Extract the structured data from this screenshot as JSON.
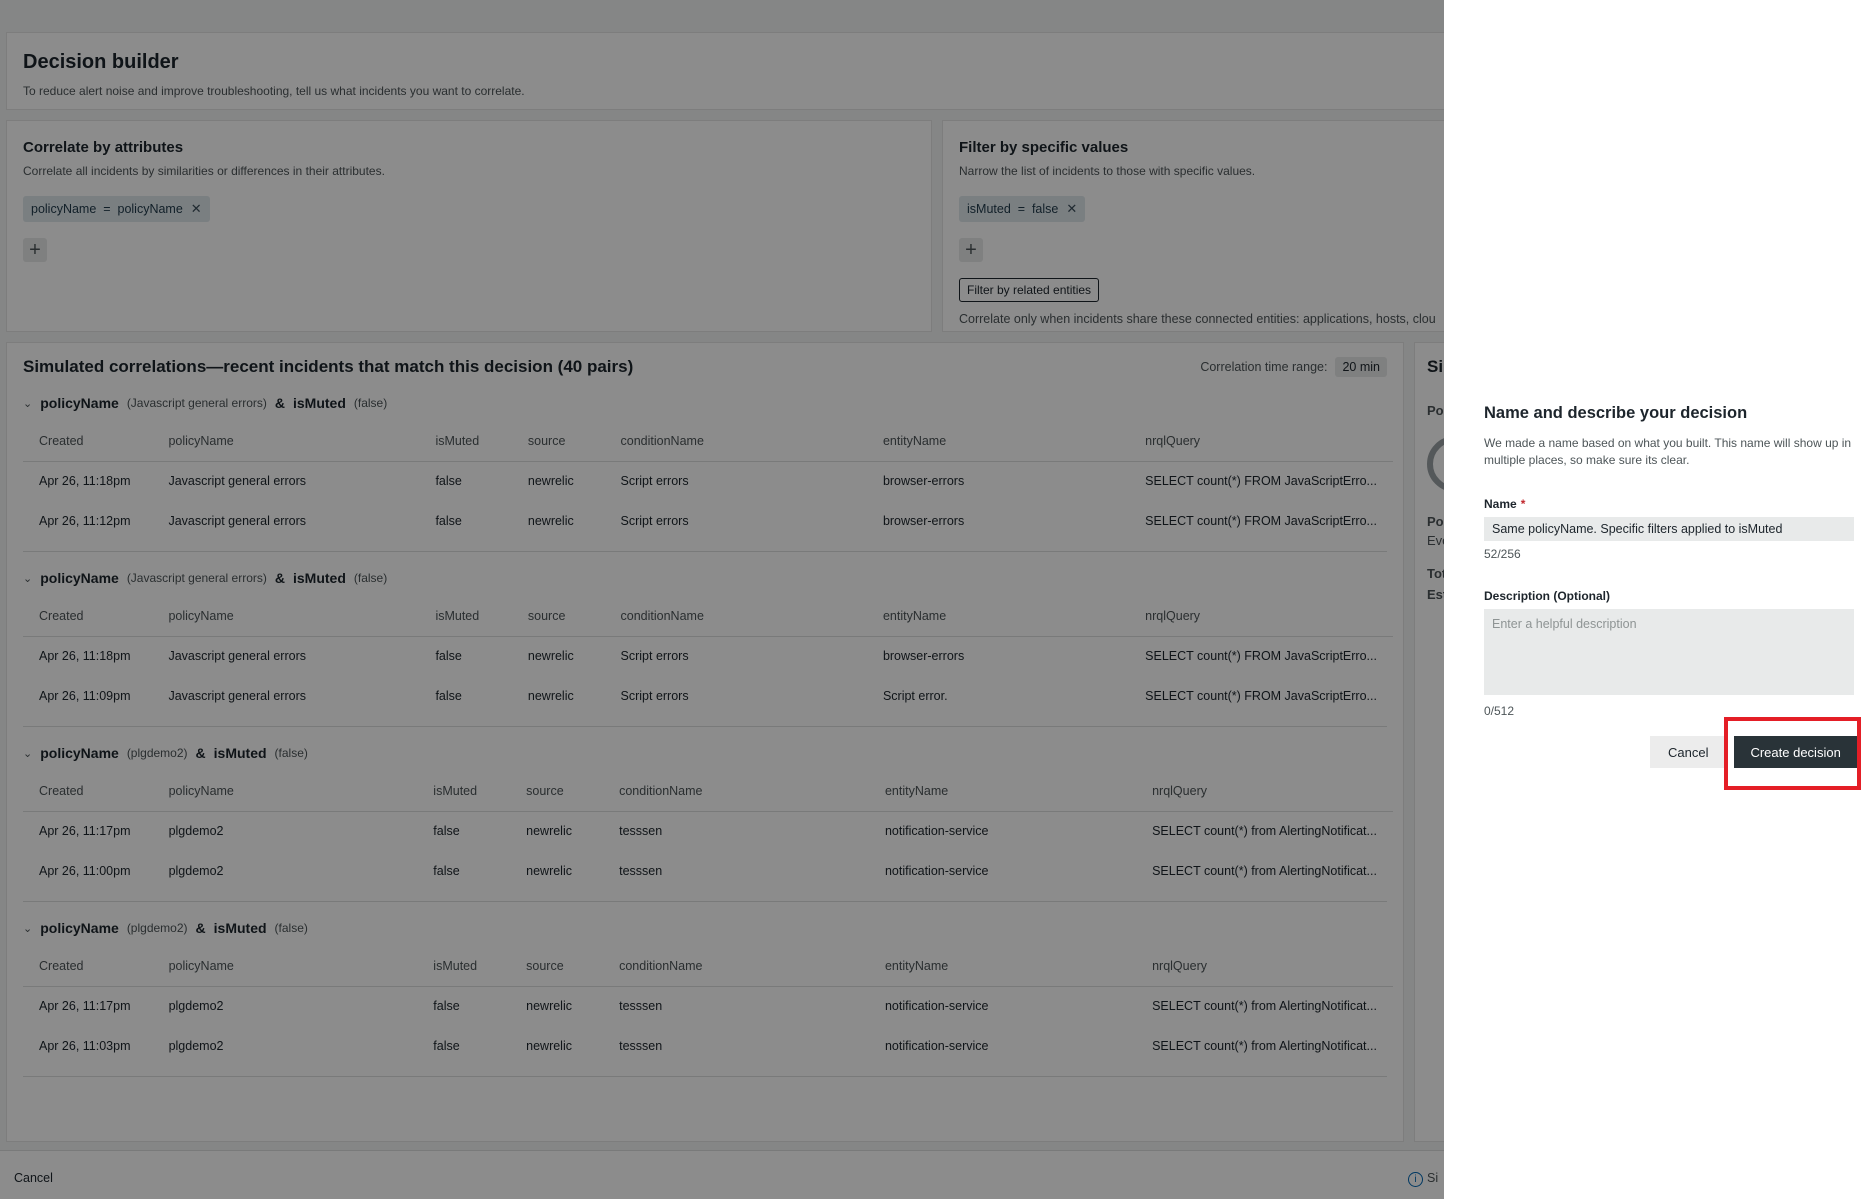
{
  "header": {
    "title": "Decision builder",
    "subtitle": "To reduce alert noise and improve troubleshooting, tell us what incidents you want to correlate."
  },
  "correlate": {
    "title": "Correlate by attributes",
    "subtitle": "Correlate all incidents by similarities or differences in their attributes.",
    "pill_label": "policyName  =  policyName"
  },
  "filter": {
    "title": "Filter by specific values",
    "subtitle": "Narrow the list of incidents to those with specific values.",
    "pill_label": "isMuted  =  false",
    "related_button": "Filter by related entities",
    "related_text": "Correlate only when incidents share these connected entities: applications, hosts, clou"
  },
  "simulation": {
    "title": "Simulated correlations—recent incidents that match this decision (40 pairs)",
    "range_label": "Correlation time range:",
    "range_value": "20 min",
    "columns": [
      "Created",
      "policyName",
      "isMuted",
      "source",
      "conditionName",
      "entityName",
      "nrqlQuery"
    ],
    "groups": [
      {
        "name_a": "policyName",
        "val_a": "(Javascript general errors)",
        "amp": "&",
        "name_b": "isMuted",
        "val_b": "(false)",
        "rows": [
          [
            "Apr 26, 11:18pm",
            "Javascript general errors",
            "false",
            "newrelic",
            "Script errors",
            "browser-errors",
            "SELECT count(*) FROM JavaScriptErro..."
          ],
          [
            "Apr 26, 11:12pm",
            "Javascript general errors",
            "false",
            "newrelic",
            "Script errors",
            "browser-errors",
            "SELECT count(*) FROM JavaScriptErro..."
          ]
        ]
      },
      {
        "name_a": "policyName",
        "val_a": "(Javascript general errors)",
        "amp": "&",
        "name_b": "isMuted",
        "val_b": "(false)",
        "rows": [
          [
            "Apr 26, 11:18pm",
            "Javascript general errors",
            "false",
            "newrelic",
            "Script errors",
            "browser-errors",
            "SELECT count(*) FROM JavaScriptErro..."
          ],
          [
            "Apr 26, 11:09pm",
            "Javascript general errors",
            "false",
            "newrelic",
            "Script errors",
            "Script error.",
            "SELECT count(*) FROM JavaScriptErro..."
          ]
        ]
      },
      {
        "name_a": "policyName",
        "val_a": "(plgdemo2)",
        "amp": "&",
        "name_b": "isMuted",
        "val_b": "(false)",
        "rows": [
          [
            "Apr 26, 11:17pm",
            "plgdemo2",
            "false",
            "newrelic",
            "tesssen",
            "notification-service",
            "SELECT count(*) from AlertingNotificat..."
          ],
          [
            "Apr 26, 11:00pm",
            "plgdemo2",
            "false",
            "newrelic",
            "tesssen",
            "notification-service",
            "SELECT count(*) from AlertingNotificat..."
          ]
        ]
      },
      {
        "name_a": "policyName",
        "val_a": "(plgdemo2)",
        "amp": "&",
        "name_b": "isMuted",
        "val_b": "(false)",
        "rows": [
          [
            "Apr 26, 11:17pm",
            "plgdemo2",
            "false",
            "newrelic",
            "tesssen",
            "notification-service",
            "SELECT count(*) from AlertingNotificat..."
          ],
          [
            "Apr 26, 11:03pm",
            "plgdemo2",
            "false",
            "newrelic",
            "tesssen",
            "notification-service",
            "SELECT count(*) from AlertingNotificat..."
          ]
        ]
      }
    ]
  },
  "right_col": {
    "title": "Si",
    "line1": "Po",
    "line2": "Po",
    "line3": "Eve",
    "line4": "Tot",
    "line5": "Est"
  },
  "footer": {
    "cancel": "Cancel",
    "info": "Si"
  },
  "panel": {
    "title": "Name and describe your decision",
    "description": "We made a name based on what you built. This name will show up in multiple places, so make sure its clear.",
    "name_label": "Name",
    "name_required": "*",
    "name_value": "Same policyName. Specific filters applied to isMuted",
    "name_count": "52/256",
    "desc_label": "Description (Optional)",
    "desc_placeholder": "Enter a helpful description",
    "desc_count": "0/512",
    "cancel": "Cancel",
    "create": "Create decision"
  },
  "colors": {
    "highlight": "#e41e26",
    "primary_button": "#293338"
  }
}
